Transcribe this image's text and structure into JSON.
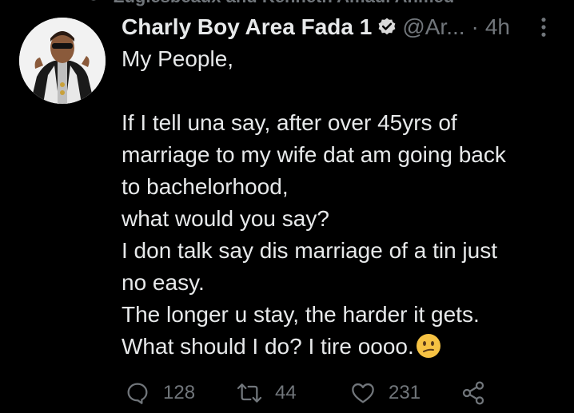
{
  "social_context": {
    "text": "Zugiesbeaux and Kenneth Amadi Ahmed"
  },
  "tweet": {
    "author_name": "Charly Boy Area Fada 1",
    "handle": "@Ar...",
    "separator": "·",
    "time": "4h",
    "lines": [
      "My People,",
      "",
      "If I tell una say, after over 45yrs of",
      "marriage to my wife dat am going back",
      "to bachelorhood,",
      "what would you say?",
      "I don talk say dis marriage of a tin just",
      "no easy.",
      "The longer u stay, the harder it gets.",
      "What should I do? I tire oooo."
    ],
    "emoji": "confused-face"
  },
  "actions": {
    "replies": "128",
    "retweets": "44",
    "likes": "231"
  },
  "colors": {
    "background": "#000000",
    "text": "#e7e9ea",
    "muted": "#71767b",
    "emoji": "#f6c243"
  }
}
